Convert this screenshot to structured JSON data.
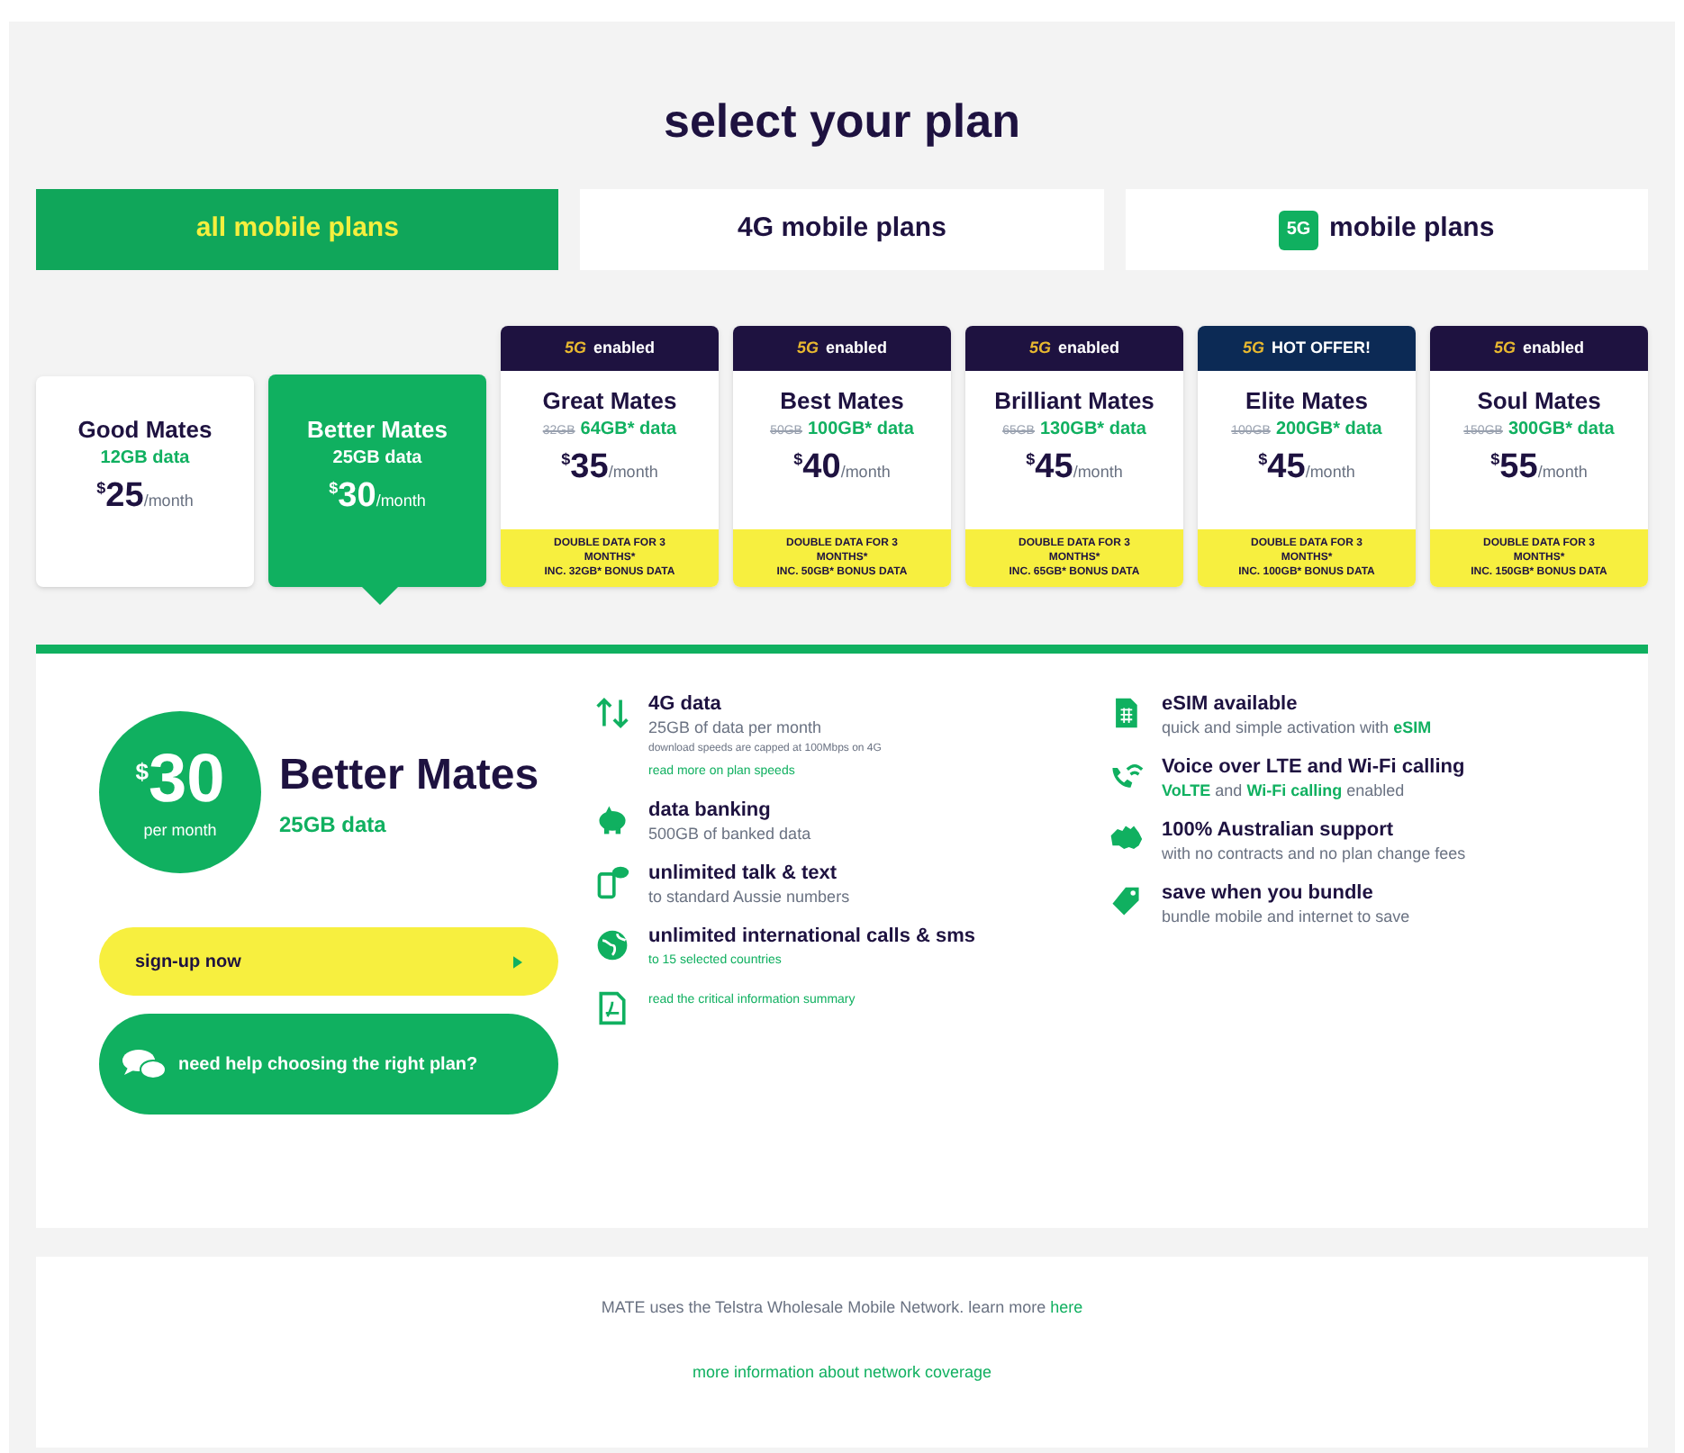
{
  "title": "select your plan",
  "tabs": [
    {
      "label": "all mobile plans",
      "selected": true
    },
    {
      "label": "4G mobile plans",
      "selected": false
    },
    {
      "label": "mobile plans",
      "badge": "5G",
      "selected": false
    }
  ],
  "plans": [
    {
      "name": "Good Mates",
      "data": "12GB data",
      "currency": "$",
      "amount": "25",
      "period": "/month",
      "selected": false
    },
    {
      "name": "Better Mates",
      "data": "25GB data",
      "currency": "$",
      "amount": "30",
      "period": "/month",
      "selected": true
    },
    {
      "name": "Great Mates",
      "old_data": "32GB",
      "data": "64GB* data",
      "currency": "$",
      "amount": "35",
      "period": "/month",
      "selected": false,
      "tag": {
        "kind": "standard",
        "badge": "5G",
        "label": "enabled"
      },
      "promo": [
        "DOUBLE DATA FOR 3",
        "MONTHS*",
        "INC. 32GB* BONUS DATA"
      ]
    },
    {
      "name": "Best Mates",
      "old_data": "50GB",
      "data": "100GB* data",
      "currency": "$",
      "amount": "40",
      "period": "/month",
      "selected": false,
      "tag": {
        "kind": "standard",
        "badge": "5G",
        "label": "enabled"
      },
      "promo": [
        "DOUBLE DATA FOR 3",
        "MONTHS*",
        "INC. 50GB* BONUS DATA"
      ]
    },
    {
      "name": "Brilliant Mates",
      "old_data": "65GB",
      "data": "130GB* data",
      "currency": "$",
      "amount": "45",
      "period": "/month",
      "selected": false,
      "tag": {
        "kind": "standard",
        "badge": "5G",
        "label": "enabled"
      },
      "promo": [
        "DOUBLE DATA FOR 3",
        "MONTHS*",
        "INC. 65GB* BONUS DATA"
      ]
    },
    {
      "name": "Elite Mates",
      "old_data": "100GB",
      "data": "200GB* data",
      "currency": "$",
      "amount": "45",
      "period": "/month",
      "selected": false,
      "tag": {
        "kind": "hot",
        "badge": "5G",
        "label": "HOT OFFER!"
      },
      "promo": [
        "DOUBLE DATA FOR 3",
        "MONTHS*",
        "INC. 100GB* BONUS DATA"
      ]
    },
    {
      "name": "Soul Mates",
      "old_data": "150GB",
      "data": "300GB* data",
      "currency": "$",
      "amount": "55",
      "period": "/month",
      "selected": false,
      "tag": {
        "kind": "standard",
        "badge": "5G",
        "label": "enabled"
      },
      "promo": [
        "DOUBLE DATA FOR 3",
        "MONTHS*",
        "INC. 150GB* BONUS DATA"
      ]
    }
  ],
  "detail": {
    "currency": "$",
    "amount": "30",
    "period": "per month",
    "name": "Better Mates",
    "data": "25GB data",
    "signup_button": "sign-up now",
    "help_button": "need help choosing the right plan?",
    "features": [
      {
        "kind": "arrows",
        "title": "4G data",
        "desc": "25GB of data per month",
        "note": "download speeds are capped at 100Mbps on 4G",
        "link": "read more on plan speeds"
      },
      {
        "kind": "piggy",
        "title": "data banking",
        "desc": "500GB of banked data"
      },
      {
        "kind": "phone",
        "title": "unlimited talk & text",
        "desc": "to standard Aussie numbers"
      },
      {
        "kind": "globe",
        "title": "unlimited international calls & sms",
        "link": "to 15 selected countries"
      },
      {
        "kind": "pdf",
        "link": "read the critical information summary"
      }
    ],
    "features_2": [
      {
        "kind": "sim",
        "title": "eSIM available",
        "desc": "quick and simple activation with **eSIM**"
      },
      {
        "kind": "wifi",
        "title": "Voice over LTE and Wi-Fi calling",
        "desc": "**VoLTE** and **Wi-Fi calling** enabled"
      },
      {
        "kind": "map",
        "title": "100% Australian support",
        "desc": "with no contracts and no plan change fees"
      },
      {
        "kind": "tag",
        "title": "save when you bundle",
        "desc": "bundle mobile and internet to save"
      }
    ]
  },
  "footer": {
    "text": "MATE uses the Telstra Wholesale Mobile Network. learn more",
    "link": "here",
    "coverage_link": "more information about network coverage"
  }
}
